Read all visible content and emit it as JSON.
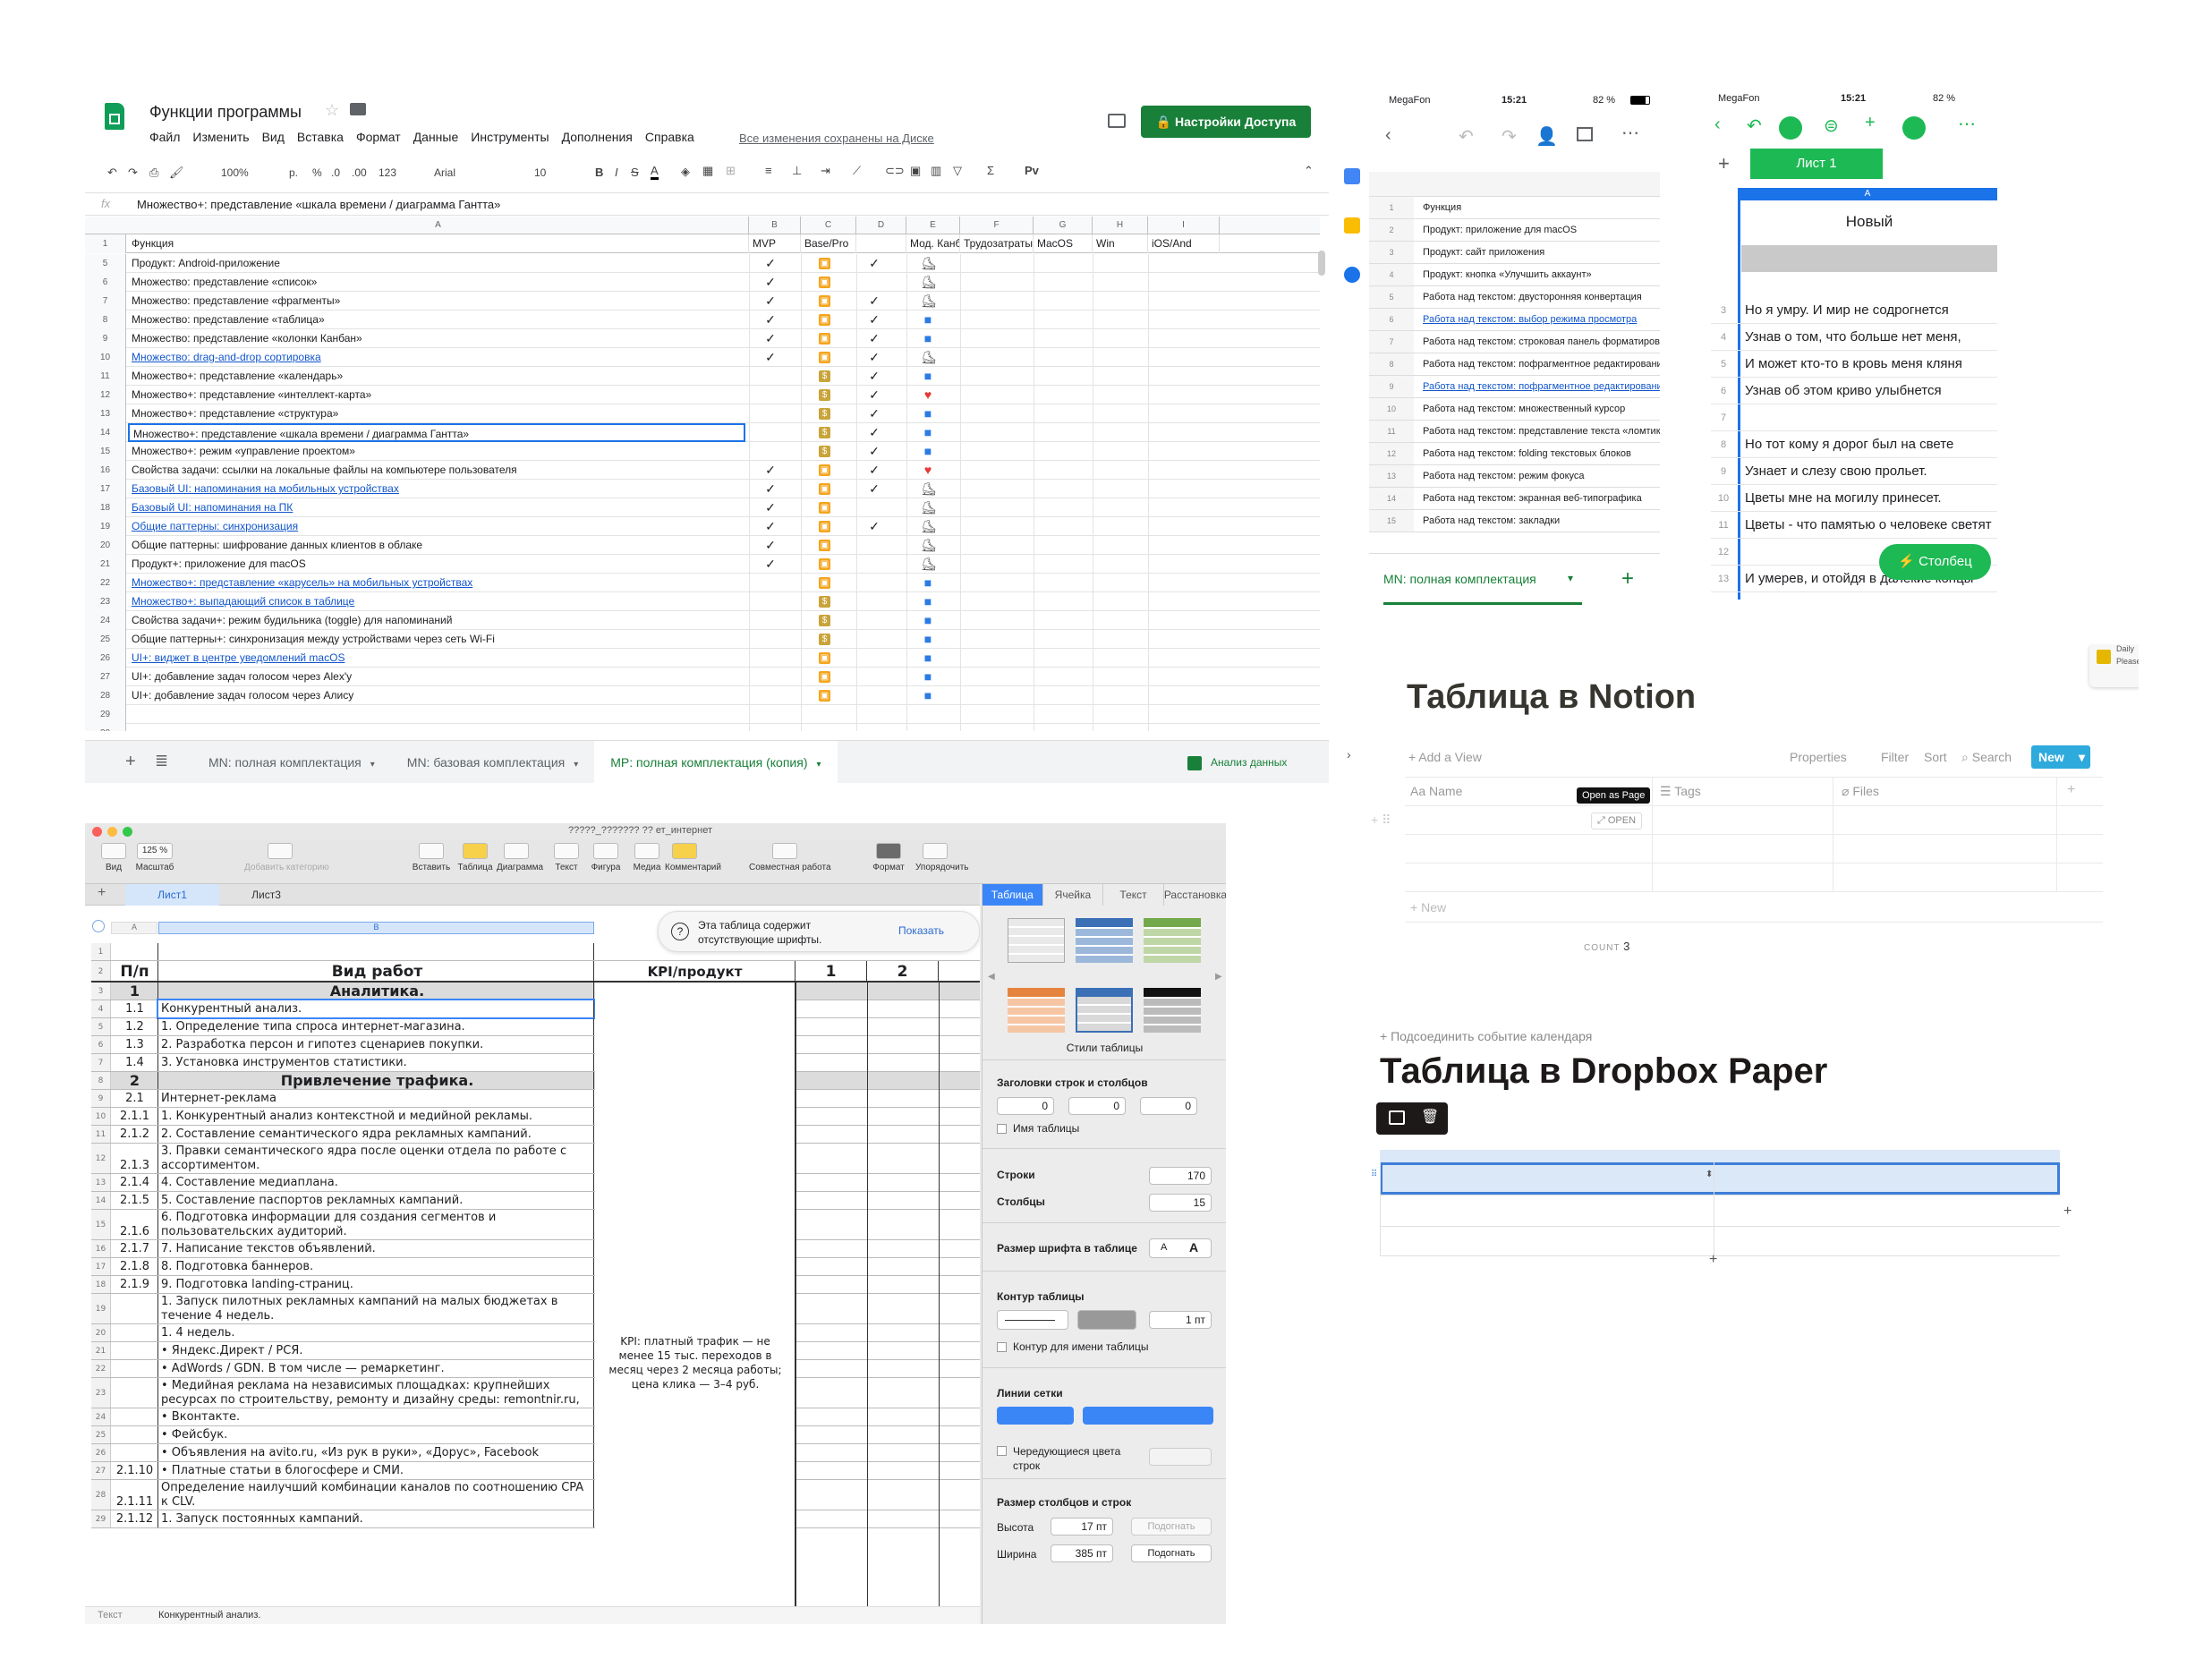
{
  "gs": {
    "title": "Функции программы",
    "menus": [
      "Файл",
      "Изменить",
      "Вид",
      "Вставка",
      "Формат",
      "Данные",
      "Инструменты",
      "Дополнения",
      "Справка"
    ],
    "saved": "Все изменения сохранены на Диске",
    "share": "Настройки Доступа",
    "zoom": "100%",
    "font": "Arial",
    "size": "10",
    "fmt_p": "р.",
    "fmt_pct": "%",
    "fmt_dec0": ".0",
    "fmt_dec00": ".00",
    "fmt_123": "123",
    "formula": "Множество+: представление «шкала времени / диаграмма Гантта»",
    "fx": "fx",
    "cols": [
      "A",
      "B",
      "C",
      "D",
      "E",
      "F",
      "G",
      "H",
      "I"
    ],
    "headers": [
      "Функция",
      "MVP",
      "Base/Pro",
      "",
      "Мод. Канб",
      "Трудозатраты",
      "MacOS",
      "Win",
      "iOS/And"
    ],
    "rows": [
      {
        "n": "5",
        "t": "Продукт: Android-приложение",
        "link": false,
        "b": "✓",
        "c": "pro",
        "d": "✓",
        "e": "scooter"
      },
      {
        "n": "6",
        "t": "Множество: представление «список»",
        "link": false,
        "b": "✓",
        "c": "pro",
        "d": "",
        "e": "scooter"
      },
      {
        "n": "7",
        "t": "Множество: представление «фрагменты»",
        "link": false,
        "b": "✓",
        "c": "pro",
        "d": "✓",
        "e": "scooter"
      },
      {
        "n": "8",
        "t": "Множество: представление «таблица»",
        "link": false,
        "b": "✓",
        "c": "pro",
        "d": "✓",
        "e": "car"
      },
      {
        "n": "9",
        "t": "Множество: представление «колонки Канбан»",
        "link": false,
        "b": "✓",
        "c": "pro",
        "d": "✓",
        "e": "car"
      },
      {
        "n": "10",
        "t": "Множество: drag-and-drop сортировка",
        "link": true,
        "b": "✓",
        "c": "pro",
        "d": "✓",
        "e": "scooter"
      },
      {
        "n": "11",
        "t": "Множество+: представление «календарь»",
        "link": false,
        "b": "",
        "c": "bag",
        "d": "✓",
        "e": "car"
      },
      {
        "n": "12",
        "t": "Множество+: представление «интеллект-карта»",
        "link": false,
        "b": "",
        "c": "bag",
        "d": "✓",
        "e": "heart"
      },
      {
        "n": "13",
        "t": "Множество+: представление «структура»",
        "link": false,
        "b": "",
        "c": "bag",
        "d": "✓",
        "e": "car"
      },
      {
        "n": "14",
        "t": "Множество+: представление «шкала времени / диаграмма Гантта»",
        "link": false,
        "b": "",
        "c": "bag",
        "d": "✓",
        "e": "car",
        "sel": true
      },
      {
        "n": "15",
        "t": "Множество+: режим «управление проектом»",
        "link": false,
        "b": "",
        "c": "bag",
        "d": "✓",
        "e": "car"
      },
      {
        "n": "16",
        "t": "Свойства задачи: ссылки на локальные файлы на компьютере пользователя",
        "link": false,
        "b": "✓",
        "c": "pro",
        "d": "✓",
        "e": "heart"
      },
      {
        "n": "17",
        "t": "Базовый UI: напоминания на мобильных устройствах",
        "link": true,
        "b": "✓",
        "c": "pro",
        "d": "✓",
        "e": "scooter"
      },
      {
        "n": "18",
        "t": "Базовый UI: напоминания на ПК",
        "link": true,
        "b": "✓",
        "c": "pro",
        "d": "",
        "e": "scooter"
      },
      {
        "n": "19",
        "t": "Общие паттерны: синхронизация",
        "link": true,
        "b": "✓",
        "c": "pro",
        "d": "✓",
        "e": "scooter"
      },
      {
        "n": "20",
        "t": "Общие паттерны: шифрование данных клиентов в облаке",
        "link": false,
        "b": "✓",
        "c": "pro",
        "d": "",
        "e": "scooter"
      },
      {
        "n": "21",
        "t": "Продукт+: приложение для macOS",
        "link": false,
        "b": "✓",
        "c": "pro",
        "d": "",
        "e": "scooter"
      },
      {
        "n": "22",
        "t": "Множество+: представление «карусель» на мобильных устройствах",
        "link": true,
        "b": "",
        "c": "pro",
        "d": "",
        "e": "car"
      },
      {
        "n": "23",
        "t": "Множество+: выпадающий список в таблице",
        "link": true,
        "b": "",
        "c": "bag",
        "d": "",
        "e": "car"
      },
      {
        "n": "24",
        "t": "Свойства задачи+: режим будильника (toggle) для напоминаний",
        "link": false,
        "b": "",
        "c": "bag",
        "d": "",
        "e": "car"
      },
      {
        "n": "25",
        "t": "Общие паттерны+: синхронизация между устройствами через сеть Wi-Fi",
        "link": false,
        "b": "",
        "c": "bag",
        "d": "",
        "e": "car"
      },
      {
        "n": "26",
        "t": "UI+: виджет в центре уведомлений macOS",
        "link": true,
        "b": "",
        "c": "pro",
        "d": "",
        "e": "car"
      },
      {
        "n": "27",
        "t": "UI+: добавление задач голосом через Alex'y",
        "link": false,
        "b": "",
        "c": "pro",
        "d": "",
        "e": "car"
      },
      {
        "n": "28",
        "t": "UI+: добавление задач голосом через Алису",
        "link": false,
        "b": "",
        "c": "pro",
        "d": "",
        "e": "car"
      },
      {
        "n": "29",
        "t": "",
        "link": false,
        "b": "",
        "c": "",
        "d": "",
        "e": ""
      },
      {
        "n": "30",
        "t": "",
        "link": false,
        "b": "",
        "c": "",
        "d": "",
        "e": ""
      }
    ],
    "tabs": [
      "MN: полная комплектация",
      "MN: базовая комплектация",
      "MP: полная комплектация (копия)"
    ],
    "explore": "Анализ данных"
  },
  "mob1": {
    "carrier": "MegaFon",
    "time": "15:21",
    "battery": "82 %",
    "rows": [
      {
        "n": "1",
        "t": "Функция",
        "link": false
      },
      {
        "n": "2",
        "t": "Продукт: приложение для macOS",
        "link": false
      },
      {
        "n": "3",
        "t": "Продукт: сайт приложения",
        "link": false
      },
      {
        "n": "4",
        "t": "Продукт: кнопка «Улучшить аккаунт»",
        "link": false
      },
      {
        "n": "5",
        "t": "Работа над текстом: двусторонняя конвертация",
        "link": false
      },
      {
        "n": "6",
        "t": "Работа над текстом: выбор режима просмотра",
        "link": true
      },
      {
        "n": "7",
        "t": "Работа над текстом: строковая панель форматирования",
        "link": false
      },
      {
        "n": "8",
        "t": "Работа над текстом: пофрагментное редактирование",
        "link": false
      },
      {
        "n": "9",
        "t": "Работа над текстом: пофрагментное редактирование",
        "link": true
      },
      {
        "n": "10",
        "t": "Работа над текстом: множественный курсор",
        "link": false
      },
      {
        "n": "11",
        "t": "Работа над текстом: представление текста «ломтиками»",
        "link": false
      },
      {
        "n": "12",
        "t": "Работа над текстом: folding текстовых блоков",
        "link": false
      },
      {
        "n": "13",
        "t": "Работа над текстом: режим фокуса",
        "link": false
      },
      {
        "n": "14",
        "t": "Работа над текстом: экранная веб-типографика",
        "link": false
      },
      {
        "n": "15",
        "t": "Работа над текстом: закладки",
        "link": false
      }
    ],
    "sheet": "MN: полная комплектация"
  },
  "mob2": {
    "carrier": "MegaFon",
    "time": "15:21",
    "battery": "82 %",
    "sheet": "Лист 1",
    "col": "A",
    "header": "Новый",
    "rows": [
      {
        "n": "3",
        "t": "Но я умру. И мир не содрогнется"
      },
      {
        "n": "4",
        "t": "Узнав о том, что больше нет меня,"
      },
      {
        "n": "5",
        "t": "И может кто-то в кровь меня кляня"
      },
      {
        "n": "6",
        "t": "Узнав об этом криво улыбнется"
      },
      {
        "n": "7",
        "t": ""
      },
      {
        "n": "8",
        "t": "Но тот кому я дорог был на свете"
      },
      {
        "n": "9",
        "t": "Узнает и слезу свою прольет."
      },
      {
        "n": "10",
        "t": "Цветы мне на могилу принесет."
      },
      {
        "n": "11",
        "t": "Цветы - что памятью о человеке светят"
      },
      {
        "n": "12",
        "t": ""
      },
      {
        "n": "13",
        "t": "И умерев, и отойдя в далекие концы"
      }
    ],
    "fab": "Столбец"
  },
  "notion": {
    "title": "Таблица в Notion",
    "add_view": "Add a View",
    "properties": "Properties",
    "filter": "Filter",
    "sort": "Sort",
    "search": "Search",
    "new": "New",
    "col_name": "Name",
    "col_tags": "Tags",
    "col_files": "Files",
    "tooltip": "Open as Page",
    "open": "OPEN",
    "new_row": "New",
    "count_label": "COUNT",
    "count": "3",
    "widget_1": "Daily",
    "widget_2": "Please"
  },
  "dropbox": {
    "link": "+ Подсоединить событие календаря",
    "title": "Таблица в Dropbox Paper"
  },
  "numbers": {
    "window_title": "?????_??????? ?? ет_интернет",
    "toolbar": [
      "Вид",
      "Масштаб",
      "Добавить категорию",
      "Вставить",
      "Таблица",
      "Диаграмма",
      "Текст",
      "Фигура",
      "Медиа",
      "Комментарий",
      "Совместная работа",
      "Формат",
      "Упорядочить"
    ],
    "zoom": "125 %",
    "sheets": [
      "Лист1",
      "Лист3"
    ],
    "inspector_tabs": [
      "Таблица",
      "Ячейка",
      "Текст",
      "Расстановка"
    ],
    "fonts_warning": "Эта таблица содержит отсутствующие шрифты.",
    "show": "Показать",
    "col_a": "A",
    "col_b": "B",
    "head": {
      "pp": "П/п",
      "vid": "Вид работ",
      "kpi": "KPI/продукт",
      "c1": "1",
      "c2": "2"
    },
    "rows": [
      {
        "n": "3",
        "a": "1",
        "b": "Аналитика.",
        "sec": true
      },
      {
        "n": "4",
        "a": "1.1",
        "b": "Конкурентный анализ."
      },
      {
        "n": "5",
        "a": "1.2",
        "b": "1. Определение типа спроса интернет-магазина."
      },
      {
        "n": "6",
        "a": "1.3",
        "b": "2. Разработка персон и гипотез сценариев покупки."
      },
      {
        "n": "7",
        "a": "1.4",
        "b": "3. Установка инструментов статистики."
      },
      {
        "n": "8",
        "a": "2",
        "b": "Привлечение трафика.",
        "sec": true
      },
      {
        "n": "9",
        "a": "2.1",
        "b": "Интернет-реклама"
      },
      {
        "n": "10",
        "a": "2.1.1",
        "b": "1. Конкурентный анализ контекстной и медийной рекламы."
      },
      {
        "n": "11",
        "a": "2.1.2",
        "b": "2. Составление семантического ядра рекламных кампаний."
      },
      {
        "n": "12",
        "a": "2.1.3",
        "b": "3. Правки семантического ядра после оценки отдела по работе с ассортиментом.",
        "tall": true
      },
      {
        "n": "13",
        "a": "2.1.4",
        "b": "4. Составление медиаплана."
      },
      {
        "n": "14",
        "a": "2.1.5",
        "b": "5. Составление паспортов рекламных кампаний."
      },
      {
        "n": "15",
        "a": "2.1.6",
        "b": "6. Подготовка информации для создания сегментов и пользовательских аудиторий.",
        "tall": true
      },
      {
        "n": "16",
        "a": "2.1.7",
        "b": "7. Написание текстов объявлений."
      },
      {
        "n": "17",
        "a": "2.1.8",
        "b": "8. Подготовка баннеров."
      },
      {
        "n": "18",
        "a": "2.1.9",
        "b": "9. Подготовка landing-страниц."
      },
      {
        "n": "19",
        "a": "",
        "b": "1. Запуск пилотных рекламных кампаний на малых бюджетах в течение 4 недель.",
        "tall": true
      },
      {
        "n": "20",
        "a": "",
        "b": "1. 4 недель."
      },
      {
        "n": "21",
        "a": "",
        "b": "• Яндекс.Директ / РСЯ."
      },
      {
        "n": "22",
        "a": "",
        "b": "• AdWords / GDN. В том числе — ремаркетинг."
      },
      {
        "n": "23",
        "a": "",
        "b": "• Медийная реклама на независимых площадках: крупнейших ресурсах по строительству, ремонту и дизайну среды: remontnir.ru, isolux.ru,",
        "tall": true
      },
      {
        "n": "24",
        "a": "",
        "b": "• Вконтакте."
      },
      {
        "n": "25",
        "a": "",
        "b": "• Фейсбук."
      },
      {
        "n": "26",
        "a": "",
        "b": "• Объявления на avito.ru, «Из рук в руки», «Дорус», Facebook"
      },
      {
        "n": "27",
        "a": "2.1.10",
        "b": "• Платные статьи в блогосфере и СМИ."
      },
      {
        "n": "28",
        "a": "2.1.11",
        "b": "Определение наилучший комбинации каналов по соотношению CPA к CLV.",
        "tall": true
      },
      {
        "n": "29",
        "a": "2.1.12",
        "b": "1. Запуск постоянных кампаний."
      }
    ],
    "kpi_text": "KPI: платный трафик — не менее 15 тыс. переходов в месяц через 2 месяца работы; цена клика — 3–4 руб.",
    "styles_label": "Стили таблицы",
    "headers_label": "Заголовки строк и столбцов",
    "hdr_val1": "0",
    "hdr_val2": "0",
    "hdr_val3": "0",
    "table_name_label": "Имя таблицы",
    "rows_label": "Строки",
    "rows_val": "170",
    "cols_label": "Столбцы",
    "cols_val": "15",
    "font_size_label": "Размер шрифта в таблице",
    "border_label": "Контур таблицы",
    "border_val": "1 пт",
    "border_name_label": "Контур для имени таблицы",
    "grid_label": "Линии сетки",
    "alt_rows_label": "Чередующиеся цвета строк",
    "size_label": "Размер столбцов и строк",
    "height_label": "Высота",
    "height_val": "17 пт",
    "width_label": "Ширина",
    "width_val": "385 пт",
    "fit": "Подогнать",
    "status_left": "Текст",
    "status_right": "Конкурентный анализ."
  }
}
